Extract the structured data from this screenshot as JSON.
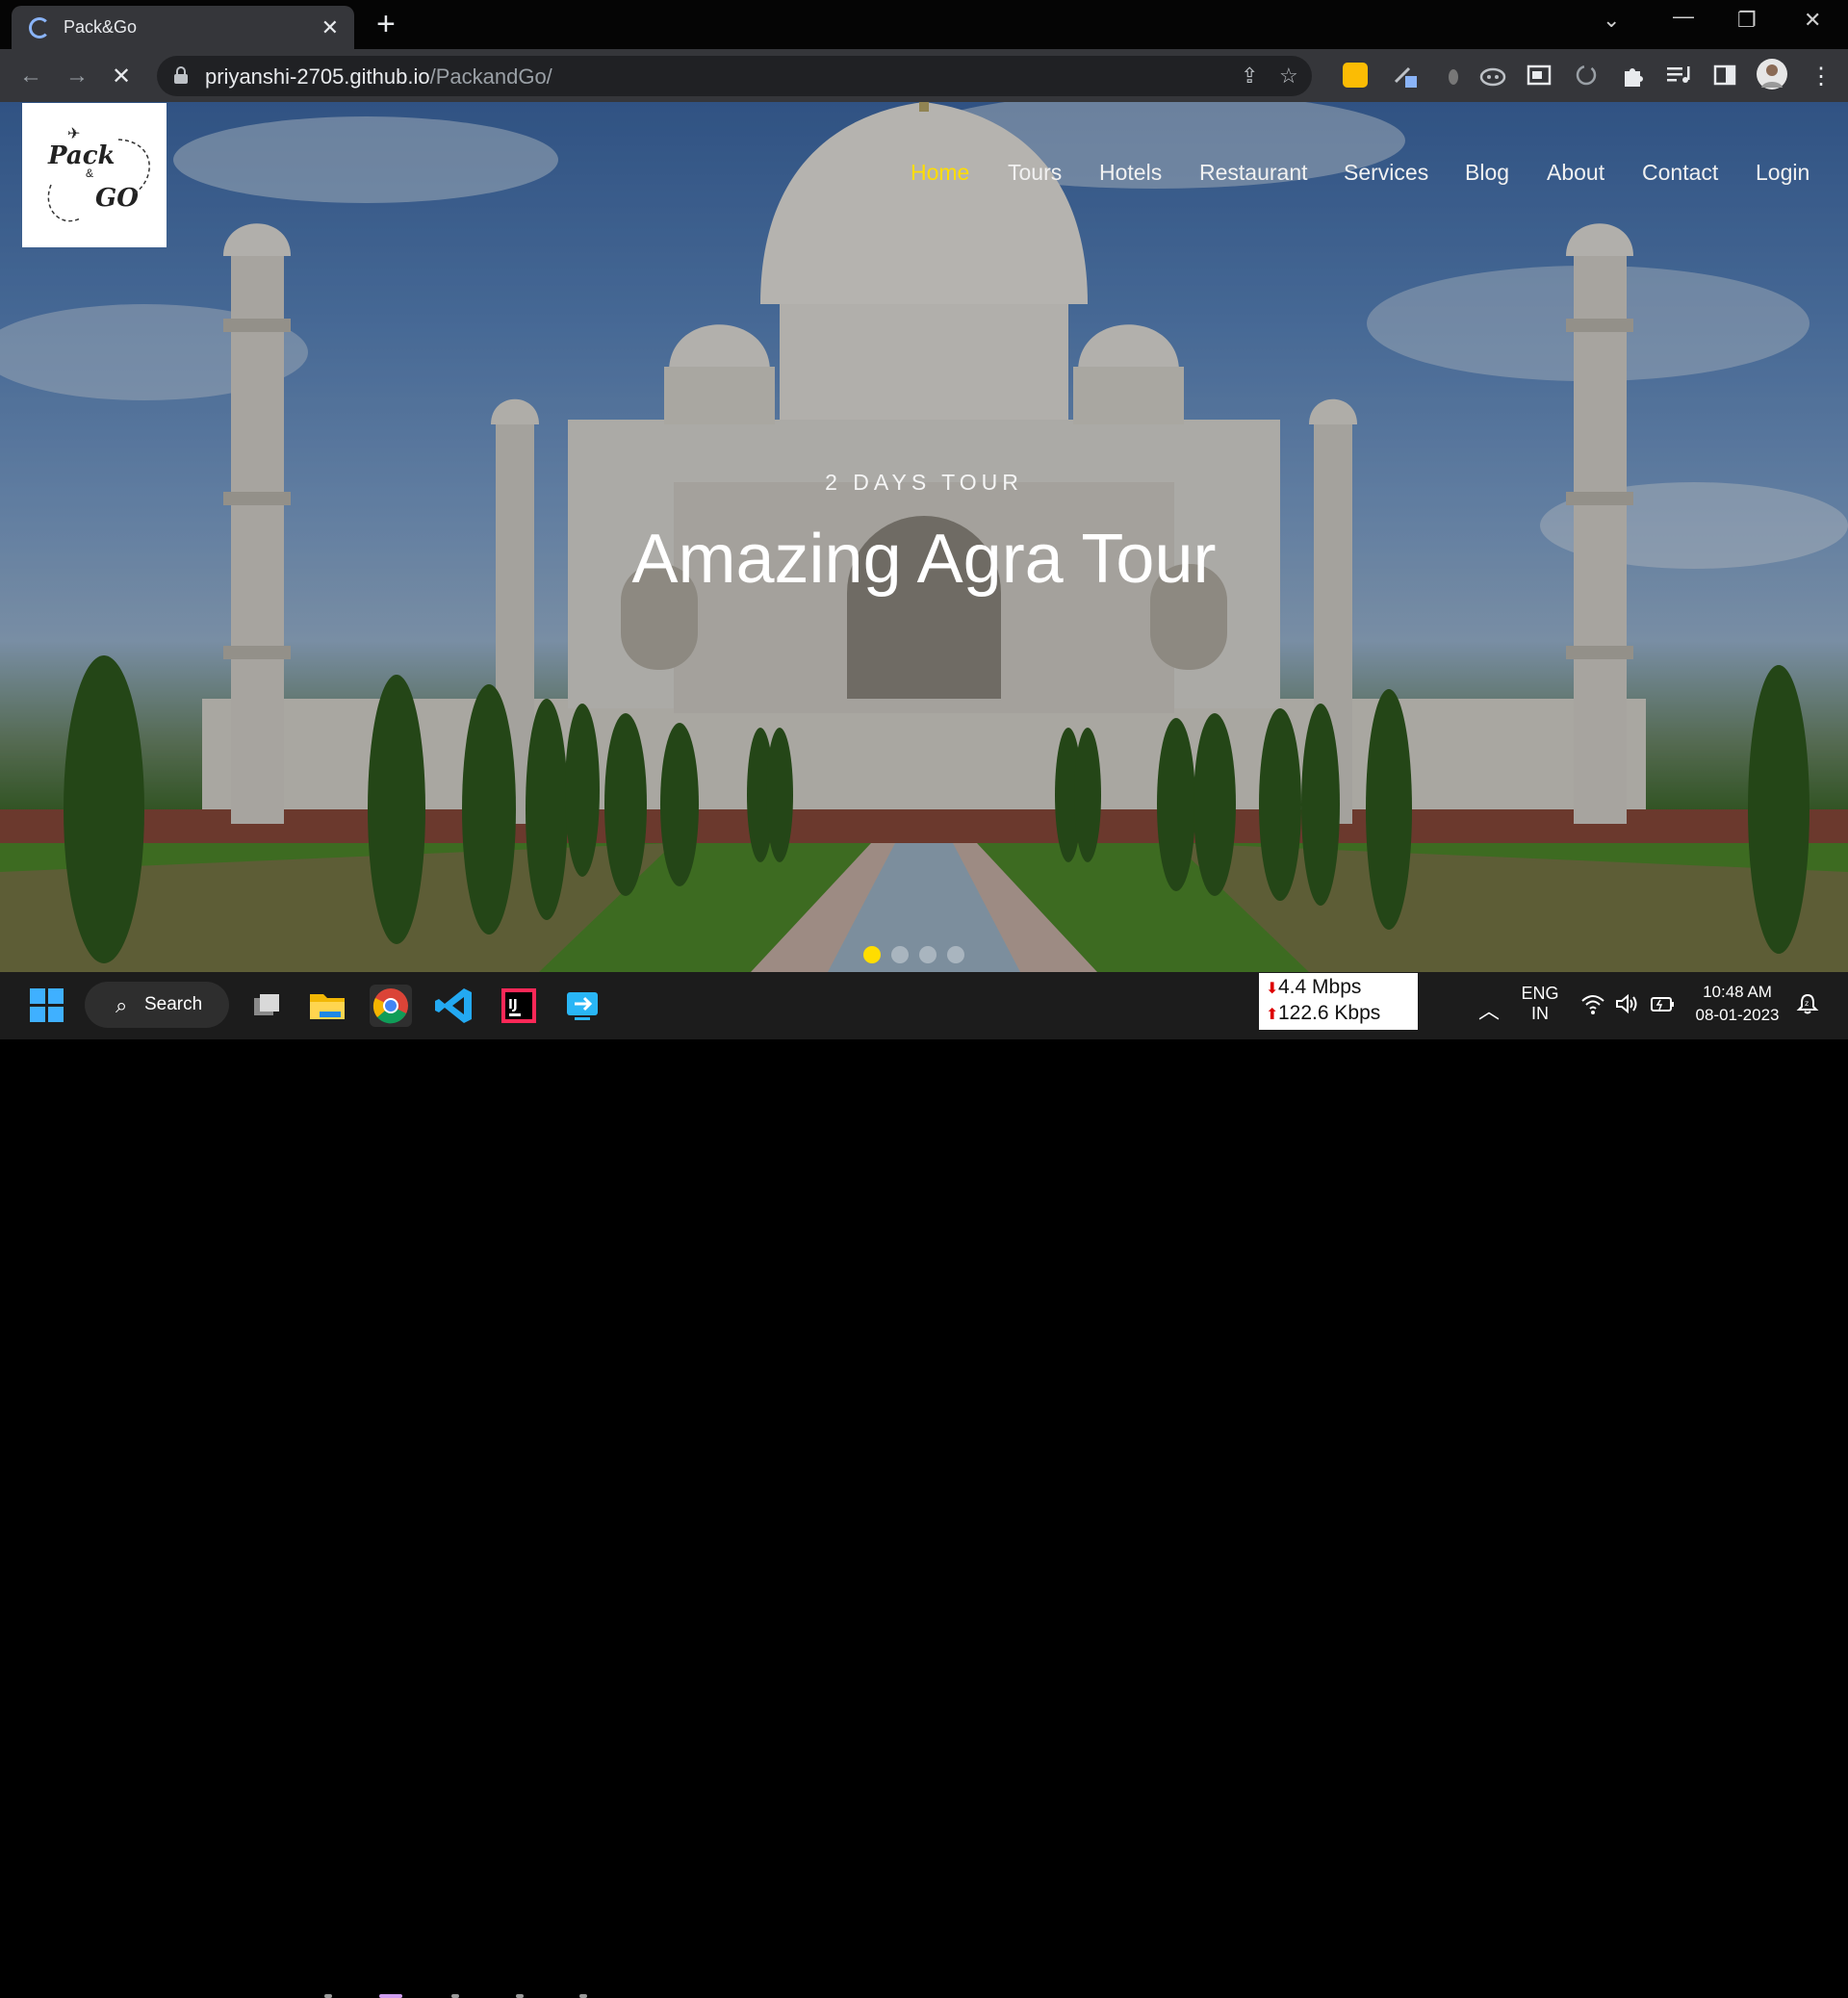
{
  "browser": {
    "tab_title": "Pack&Go",
    "url_domain": "priyanshi-2705.github.io",
    "url_path": "/PackandGo/"
  },
  "site": {
    "logo_pack": "Pack",
    "logo_amp": "&",
    "logo_go": "GO",
    "nav": [
      {
        "label": "Home",
        "active": true
      },
      {
        "label": "Tours",
        "active": false
      },
      {
        "label": "Hotels",
        "active": false
      },
      {
        "label": "Restaurant",
        "active": false
      },
      {
        "label": "Services",
        "active": false
      },
      {
        "label": "Blog",
        "active": false
      },
      {
        "label": "About",
        "active": false
      },
      {
        "label": "Contact",
        "active": false
      },
      {
        "label": "Login",
        "active": false
      }
    ],
    "hero": {
      "subtitle": "2 DAYS TOUR",
      "headline": "Amazing Agra Tour",
      "slide_count": 4,
      "active_slide": 1
    },
    "accent_color": "#ffdd00"
  },
  "taskbar": {
    "search_label": "Search",
    "net_down": "4.4 Mbps",
    "net_up": "122.6 Kbps",
    "lang_line1": "ENG",
    "lang_line2": "IN",
    "time": "10:48 AM",
    "date": "08-01-2023"
  }
}
